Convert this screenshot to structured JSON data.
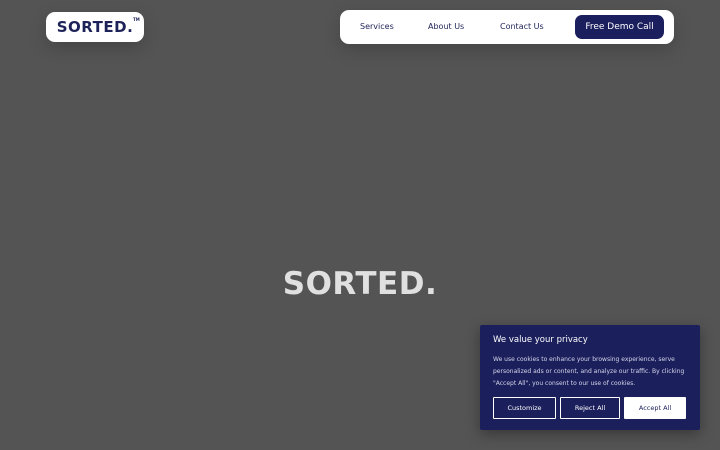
{
  "header": {
    "logo_text": "SORTED.",
    "logo_tm": "TM",
    "nav": {
      "services": "Services",
      "about": "About Us",
      "contact": "Contact Us"
    },
    "cta_label": "Free Demo Call"
  },
  "hero": {
    "title": "SORTED."
  },
  "cookie_banner": {
    "title": "We value your privacy",
    "body": "We use cookies to enhance your browsing experience, serve personalized ads or content, and analyze our traffic. By clicking \"Accept All\", you consent to our use of cookies.",
    "customize_label": "Customize",
    "reject_label": "Reject All",
    "accept_label": "Accept All"
  },
  "colors": {
    "background": "#545454",
    "brand_navy": "#1c1f5e",
    "white": "#ffffff"
  }
}
